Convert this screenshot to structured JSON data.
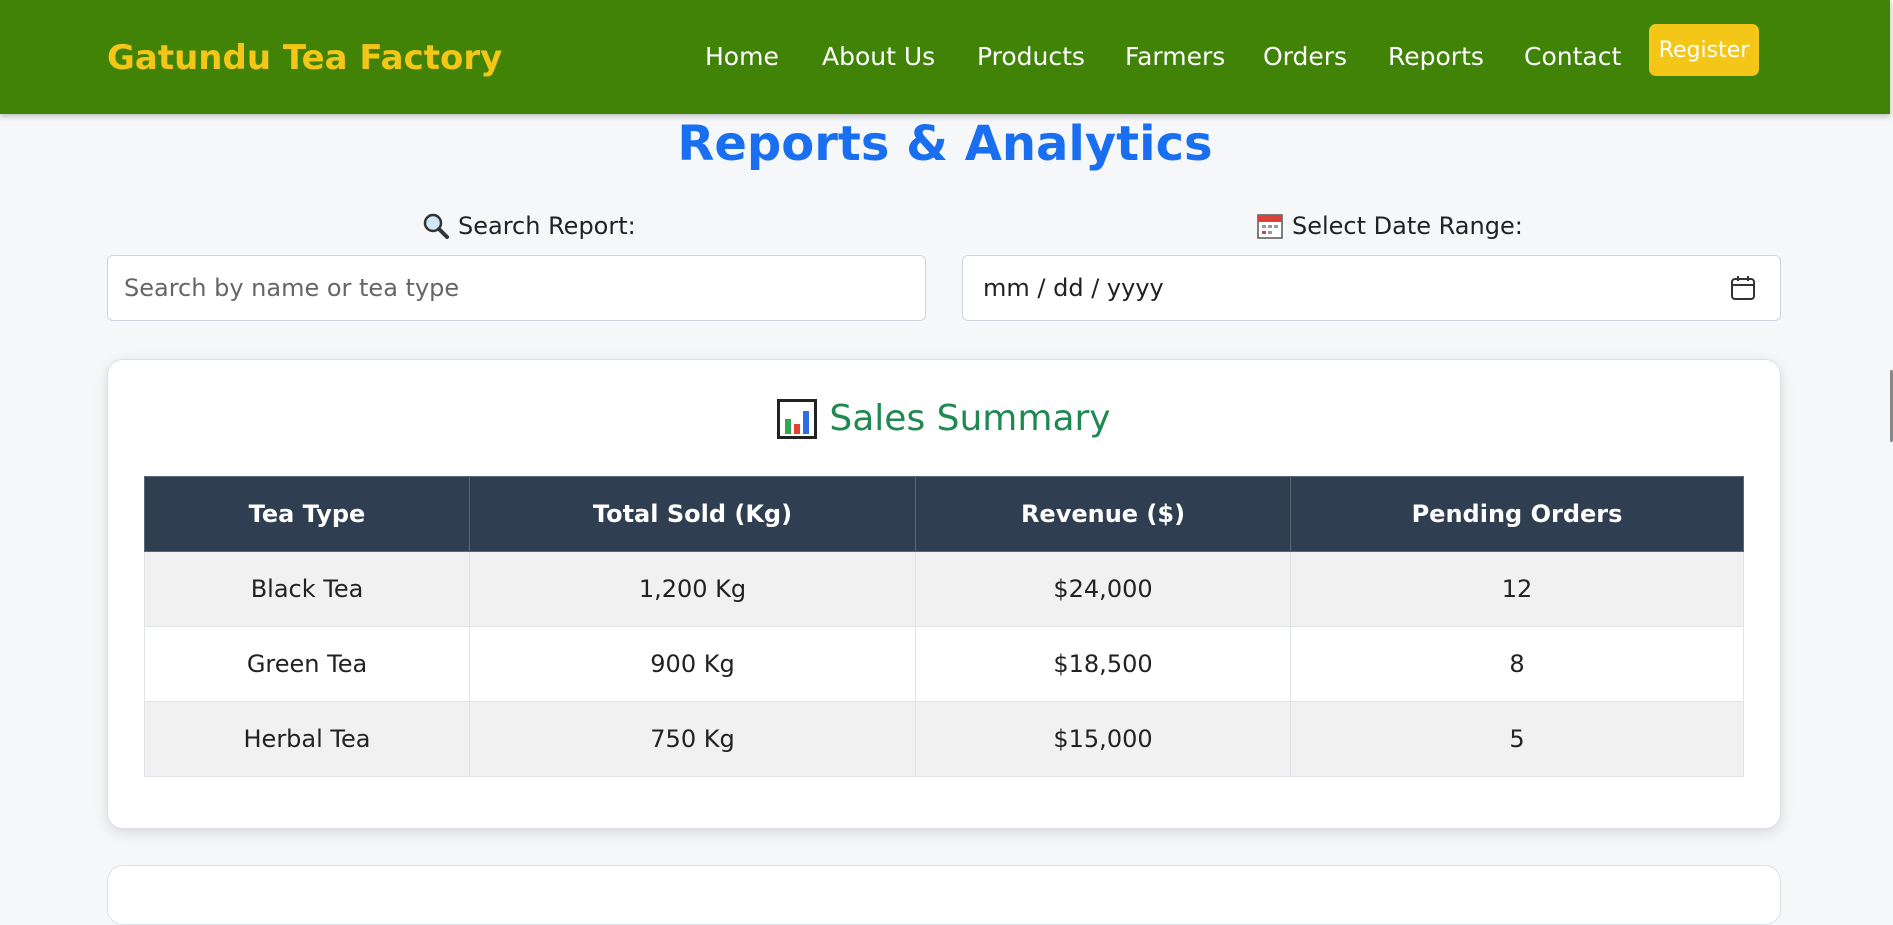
{
  "navbar": {
    "brand": "Gatundu Tea Factory",
    "links": [
      "Home",
      "About Us",
      "Products",
      "Farmers",
      "Orders",
      "Reports",
      "Contact"
    ],
    "register_label": "Register",
    "background": "#418307",
    "accent": "#f4c617"
  },
  "page": {
    "title": "Reports & Analytics",
    "title_color": "#1a6ff0"
  },
  "filters": {
    "search_label": "Search Report:",
    "search_placeholder": "Search by name or tea type",
    "search_value": "",
    "search_icon": "magnifier-icon",
    "date_label": "Select Date Range:",
    "date_value": "mm / dd / yyyy",
    "date_icon": "calendar-icon"
  },
  "sales_summary": {
    "title": "Sales Summary",
    "icon": "bar-chart-icon",
    "title_color": "#1e8a52",
    "columns": [
      "Tea Type",
      "Total Sold (Kg)",
      "Revenue ($)",
      "Pending Orders"
    ],
    "rows": [
      [
        "Black Tea",
        "1,200 Kg",
        "$24,000",
        "12"
      ],
      [
        "Green Tea",
        "900 Kg",
        "$18,500",
        "8"
      ],
      [
        "Herbal Tea",
        "750 Kg",
        "$15,000",
        "5"
      ]
    ]
  }
}
